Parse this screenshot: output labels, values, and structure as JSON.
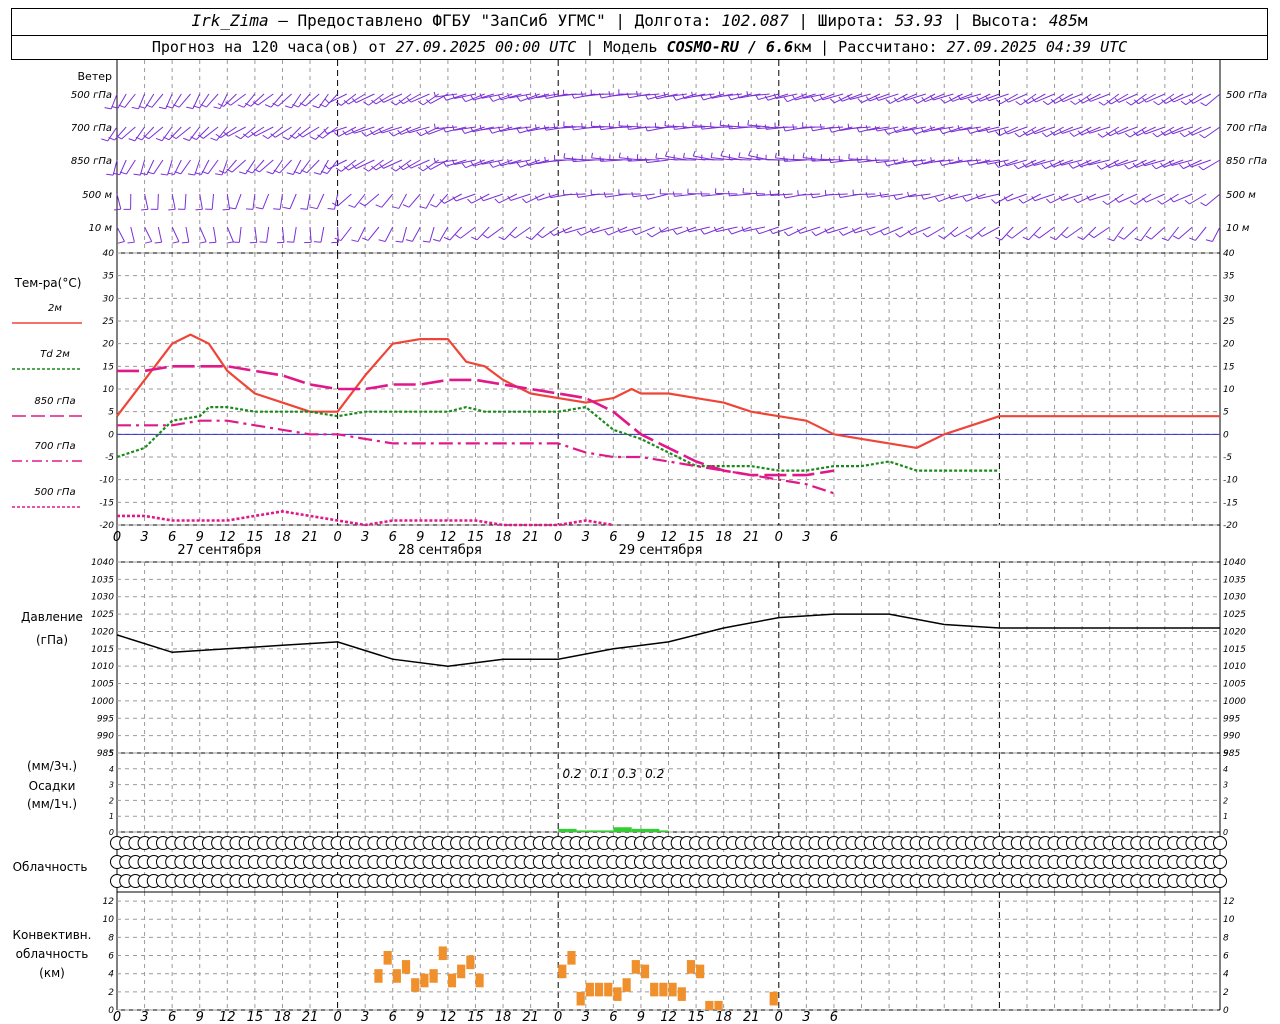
{
  "header": {
    "station": "Irk_Zima",
    "provider": "– Предоставлено ФГБУ \"ЗапСиб УГМС\" |",
    "lon_label": "Долгота:",
    "lon": "102.087",
    "lat_label": "| Широта:",
    "lat": "53.93",
    "alt_label": "| Высота:",
    "alt": "485",
    "alt_unit": "м",
    "forecast_label": "Прогноз на 120 часа(ов) от",
    "run_time": "27.09.2025 00:00 UTC",
    "model_label": "| Модель",
    "model": "COSMO-RU / 6.6",
    "model_unit": "км",
    "calc_label": "| Рассчитано:",
    "calc_time": "27.09.2025 04:39 UTC"
  },
  "wind_panel": {
    "title": "Ветер",
    "levels": [
      "500 гПа",
      "700 гПа",
      "850 гПа",
      "500 м",
      "10  м"
    ],
    "color": "#7b2fd6"
  },
  "time_axis": {
    "hour_labels": [
      "0",
      "3",
      "6",
      "9",
      "12",
      "15",
      "18",
      "21",
      "0",
      "3",
      "6",
      "9",
      "12",
      "15",
      "18",
      "21",
      "0",
      "3",
      "6",
      "9",
      "12",
      "15",
      "18",
      "21",
      "0",
      "3",
      "6"
    ],
    "day_labels": [
      "27 сентября",
      "28 сентября",
      "29 сентября"
    ]
  },
  "temp_panel": {
    "title": "Тем-ра(°C)",
    "legend": [
      {
        "label": "2м",
        "color": "#ef4438"
      },
      {
        "label": "Td  2м",
        "color": "#1a8a1a"
      },
      {
        "label": "850 гПа",
        "color": "#e0188a"
      },
      {
        "label": "700 гПа",
        "color": "#e0188a"
      },
      {
        "label": "500 гПа",
        "color": "#e0188a"
      }
    ]
  },
  "pressure_panel": {
    "title_line1": "Давление",
    "title_line2": "(гПа)"
  },
  "precip_panel": {
    "title_line1": "(мм/3ч.)",
    "title_line2": "Осадки",
    "title_line3": "(мм/1ч.)",
    "annotations": [
      "0.2",
      "0.1",
      "0.3",
      "0.2"
    ]
  },
  "cloud_panel": {
    "title": "Облачность"
  },
  "conv_panel": {
    "title_line1": "Конвективн.",
    "title_line2": "облачность",
    "title_line3": "(км)"
  },
  "chart_data": [
    {
      "type": "line",
      "name": "temperature",
      "x_unit": "hours since 27.09.2025 00:00 UTC",
      "ylim": [
        -20,
        40
      ],
      "yticks": [
        -20,
        -15,
        -10,
        -5,
        0,
        5,
        10,
        15,
        20,
        25,
        30,
        35,
        40
      ],
      "series": [
        {
          "name": "2м",
          "color": "#ef4438",
          "x": [
            0,
            3,
            6,
            8,
            10,
            12,
            15,
            18,
            21,
            24,
            27,
            30,
            33,
            36,
            38,
            40,
            42,
            45,
            48,
            51,
            54,
            56,
            57,
            60,
            63,
            66,
            69,
            72,
            75,
            78,
            81,
            84,
            87,
            90,
            93,
            96,
            99,
            102,
            105,
            108,
            111,
            114,
            117,
            120
          ],
          "values": [
            4,
            12,
            20,
            22,
            20,
            14,
            9,
            7,
            5,
            5,
            13,
            20,
            21,
            21,
            16,
            15,
            12,
            9,
            8,
            7,
            8,
            10,
            9,
            9,
            8,
            7,
            5,
            4,
            3,
            0,
            -1,
            -2,
            -3,
            0,
            2,
            4,
            4,
            4,
            4,
            4,
            4,
            4,
            4,
            4
          ]
        },
        {
          "name": "Td  2м",
          "color": "#1a8a1a",
          "x": [
            0,
            3,
            6,
            9,
            10,
            12,
            15,
            18,
            21,
            24,
            27,
            30,
            33,
            36,
            38,
            40,
            42,
            45,
            48,
            51,
            54,
            57,
            60,
            63,
            66,
            69,
            72,
            75,
            78,
            81,
            84,
            87,
            90,
            93,
            96
          ],
          "values": [
            -5,
            -3,
            3,
            4,
            6,
            6,
            5,
            5,
            5,
            4,
            5,
            5,
            5,
            5,
            6,
            5,
            5,
            5,
            5,
            6,
            1,
            -1,
            -4,
            -7,
            -7,
            -7,
            -8,
            -8,
            -7,
            -7,
            -6,
            -8,
            -8,
            -8,
            -8
          ]
        },
        {
          "name": "850 гПа",
          "color": "#e0188a",
          "x": [
            0,
            3,
            6,
            9,
            12,
            15,
            18,
            21,
            24,
            27,
            30,
            33,
            36,
            39,
            42,
            45,
            48,
            51,
            54,
            57,
            60,
            63,
            66,
            69,
            72,
            75,
            78
          ],
          "values": [
            14,
            14,
            15,
            15,
            15,
            14,
            13,
            11,
            10,
            10,
            11,
            11,
            12,
            12,
            11,
            10,
            9,
            8,
            5,
            0,
            -3,
            -6,
            -8,
            -9,
            -9,
            -9,
            -8
          ]
        },
        {
          "name": "700 гПа",
          "color": "#e0188a",
          "x": [
            0,
            3,
            6,
            9,
            12,
            15,
            18,
            21,
            24,
            27,
            30,
            33,
            36,
            39,
            42,
            45,
            48,
            51,
            54,
            57,
            60,
            63,
            66,
            69,
            72,
            75,
            78
          ],
          "values": [
            2,
            2,
            2,
            3,
            3,
            2,
            1,
            0,
            0,
            -1,
            -2,
            -2,
            -2,
            -2,
            -2,
            -2,
            -2,
            -4,
            -5,
            -5,
            -6,
            -7,
            -8,
            -9,
            -10,
            -11,
            -13
          ]
        },
        {
          "name": "500 гПа",
          "color": "#e0188a",
          "x": [
            0,
            3,
            6,
            9,
            12,
            15,
            18,
            21,
            24,
            27,
            30,
            33,
            36,
            39,
            42,
            45,
            48,
            51,
            54
          ],
          "values": [
            -18,
            -18,
            -19,
            -19,
            -19,
            -18,
            -17,
            -18,
            -19,
            -20,
            -19,
            -19,
            -19,
            -19,
            -20,
            -20,
            -20,
            -19,
            -20
          ]
        }
      ]
    },
    {
      "type": "line",
      "name": "pressure",
      "x_unit": "hours since 27.09.2025 00:00 UTC",
      "ylim": [
        985,
        1040
      ],
      "yticks": [
        985,
        990,
        995,
        1000,
        1005,
        1010,
        1015,
        1020,
        1025,
        1030,
        1035,
        1040
      ],
      "series": [
        {
          "name": "pressure",
          "color": "#000000",
          "x": [
            0,
            6,
            12,
            18,
            24,
            30,
            36,
            42,
            48,
            54,
            60,
            66,
            72,
            78,
            84,
            90,
            96,
            102,
            108,
            114,
            120
          ],
          "values": [
            1019,
            1014,
            1015,
            1016,
            1017,
            1012,
            1010,
            1012,
            1012,
            1015,
            1017,
            1021,
            1024,
            1025,
            1025,
            1022,
            1021,
            1021,
            1021,
            1021,
            1021
          ]
        }
      ]
    },
    {
      "type": "bar",
      "name": "precipitation",
      "x_unit": "hours since 27.09.2025 00:00 UTC",
      "ylim": [
        0,
        5
      ],
      "yticks": [
        0,
        1,
        2,
        3,
        4,
        5
      ],
      "x": [
        48,
        49,
        50,
        51,
        52,
        53,
        54,
        55,
        56,
        57,
        58,
        59
      ],
      "values": [
        0.2,
        0.2,
        0.1,
        0.1,
        0.1,
        0.1,
        0.3,
        0.3,
        0.2,
        0.2,
        0.2,
        0.1
      ],
      "color": "#33cc33"
    },
    {
      "type": "bar",
      "name": "convective clouds",
      "x_unit": "hours since 27.09.2025 00:00 UTC",
      "ylim": [
        0,
        13
      ],
      "yticks": [
        0,
        2,
        4,
        6,
        8,
        10,
        12
      ],
      "x": [
        28,
        29,
        30,
        31,
        32,
        33,
        34,
        35,
        36,
        37,
        38,
        39,
        48,
        49,
        50,
        51,
        52,
        53,
        54,
        55,
        56,
        57,
        58,
        59,
        60,
        61,
        62,
        63,
        64,
        65,
        71
      ],
      "values": [
        4.5,
        6.5,
        4.5,
        5.5,
        3.5,
        4,
        4.5,
        7,
        4,
        5,
        6,
        4,
        5,
        6.5,
        2,
        3,
        3,
        3,
        2.5,
        3.5,
        5.5,
        5,
        3,
        3,
        3,
        2.5,
        5.5,
        5,
        1,
        1,
        2
      ],
      "color": "#f0902c"
    }
  ],
  "cloud_layers": {
    "rows": [
      "upper",
      "middle",
      "lower"
    ],
    "note": "Cloud cover symbols per hour"
  }
}
